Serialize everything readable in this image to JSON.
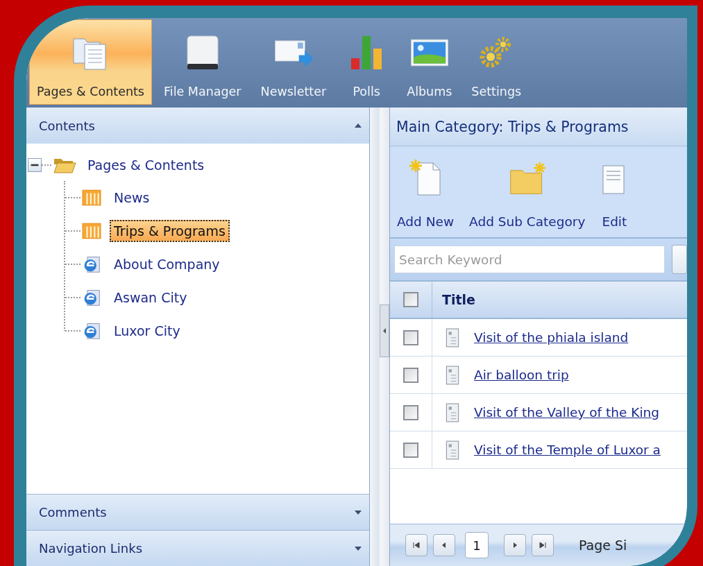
{
  "toolbar": [
    {
      "label": "Pages & Contents",
      "kind": "pages",
      "selected": true
    },
    {
      "label": "File Manager",
      "kind": "drive",
      "selected": false
    },
    {
      "label": "Newsletter",
      "kind": "mail",
      "selected": false
    },
    {
      "label": "Polls",
      "kind": "chart",
      "selected": false
    },
    {
      "label": "Albums",
      "kind": "picture",
      "selected": false
    },
    {
      "label": "Settings",
      "kind": "gears",
      "selected": false
    }
  ],
  "left_panel": {
    "sections": [
      {
        "title": "Contents",
        "expanded": true
      },
      {
        "title": "Comments",
        "expanded": false
      },
      {
        "title": "Navigation Links",
        "expanded": false
      }
    ]
  },
  "tree": {
    "label": "Pages & Contents",
    "expanded": true,
    "children": [
      {
        "label": "News",
        "kind": "category",
        "selected": false
      },
      {
        "label": "Trips & Programs",
        "kind": "category",
        "selected": true
      },
      {
        "label": "About Company",
        "kind": "page",
        "selected": false
      },
      {
        "label": "Aswan City",
        "kind": "page",
        "selected": false
      },
      {
        "label": "Luxor City",
        "kind": "page",
        "selected": false
      }
    ]
  },
  "main": {
    "title": "Main Category: Trips & Programs",
    "actions": [
      {
        "label": "Add New",
        "kind": "new-page"
      },
      {
        "label": "Add Sub Category",
        "kind": "new-folder"
      },
      {
        "label": "Edit",
        "kind": "edit"
      }
    ],
    "search": {
      "placeholder": "Search Keyword"
    },
    "table": {
      "columns": [
        "Title"
      ],
      "header_checked": false,
      "rows": [
        {
          "title": "Visit of the phiala island",
          "checked": false
        },
        {
          "title": "Air balloon trip",
          "checked": false
        },
        {
          "title": "Visit of the Valley of the King",
          "checked": false
        },
        {
          "title": "Visit of the Temple of Luxor a",
          "checked": false
        }
      ]
    },
    "pager": {
      "page": "1",
      "page_size_label": "Page Si"
    }
  }
}
